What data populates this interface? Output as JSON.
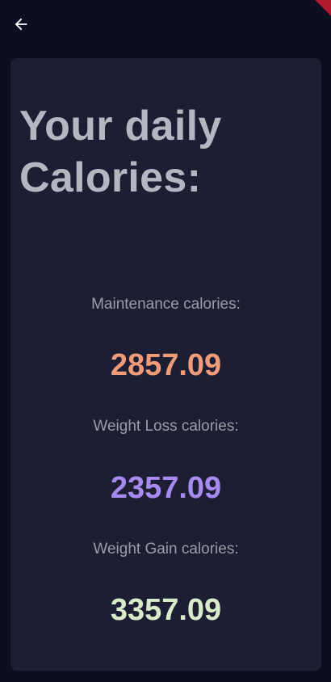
{
  "header": {
    "back_icon": "arrow-back-icon"
  },
  "card": {
    "title": "Your daily Calories:",
    "results": [
      {
        "label": "Maintenance calories:",
        "value": "2857.09",
        "color": "#f19c79"
      },
      {
        "label": "Weight Loss calories:",
        "value": "2357.09",
        "color": "#a88bf2"
      },
      {
        "label": "Weight Gain calories:",
        "value": "3357.09",
        "color": "#d9ecc9"
      }
    ]
  },
  "colors": {
    "background": "#0c0f20",
    "card": "#1d1e33",
    "title": "#b6b6c2",
    "label": "#9c9ca8"
  }
}
